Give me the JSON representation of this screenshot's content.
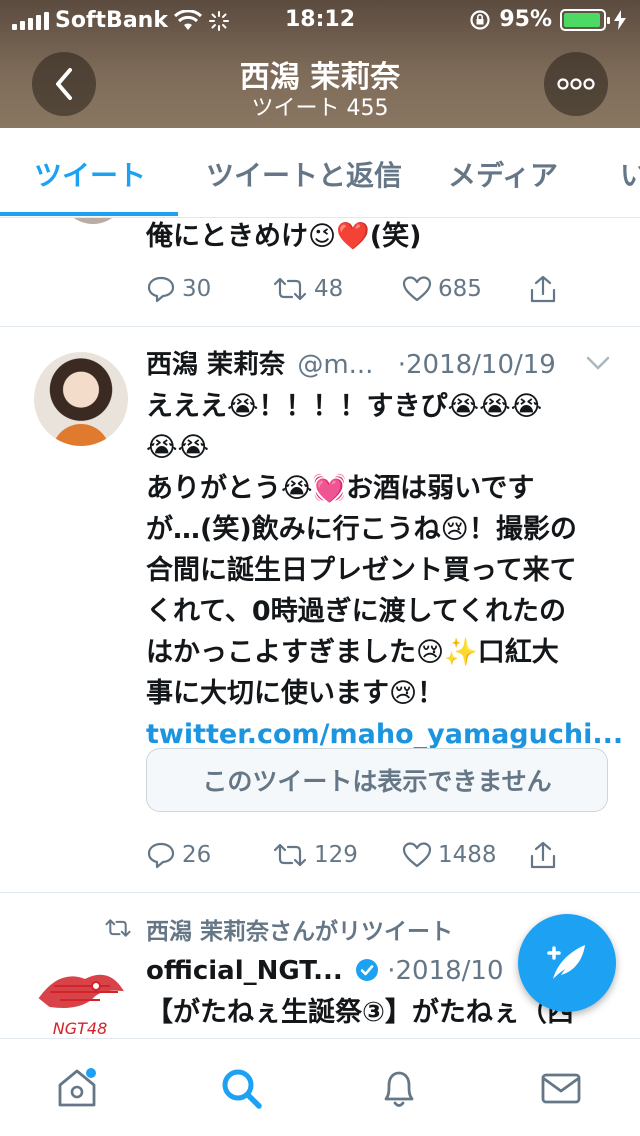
{
  "status_bar": {
    "carrier": "SoftBank",
    "time": "18:12",
    "battery": "95%",
    "battery_level": 0.95
  },
  "header": {
    "title": "西潟 茉莉奈",
    "subtitle": "ツイート 455",
    "icons": {
      "back": "chevron-left-icon",
      "more": "more-dots-icon"
    }
  },
  "tabs": [
    {
      "label": "ツイート",
      "active": true
    },
    {
      "label": "ツイートと返信",
      "active": false
    },
    {
      "label": "メディア",
      "active": false
    },
    {
      "label": "い",
      "active": false
    }
  ],
  "tweets": [
    {
      "text_line": "俺にときめけ😉❤️(笑)",
      "replies": "30",
      "retweets": "48",
      "likes": "685"
    },
    {
      "author": "西潟 茉莉奈",
      "handle": "@m...",
      "date": "·2018/10/19",
      "lines": [
        "えええ😭！！！！すきぴ😭😭😭",
        "😭😭",
        "ありがとう😭💓お酒は弱いです",
        "が…(笑)飲みに行こうね😢！撮影の",
        "合間に誕生日プレゼント買って来て",
        "くれて、0時過ぎに渡してくれたの",
        "はかっこよすぎました😢✨口紅大",
        "事に大切に使います😢！"
      ],
      "link": "twitter.com/maho_yamaguchi...",
      "card_text": "このツイートは表示できません",
      "replies": "26",
      "retweets": "129",
      "likes": "1488"
    },
    {
      "retweet_label": "西潟 茉莉奈さんがリツイート",
      "author": "official_NGT...",
      "date": "·2018/10",
      "lines": [
        "【がたねぇ生誕祭③】がたねぇ（西"
      ],
      "logo_text": "NGT48"
    }
  ],
  "bottom_nav": [
    {
      "icon": "home-icon",
      "active": false
    },
    {
      "icon": "search-icon",
      "active": true
    },
    {
      "icon": "bell-icon",
      "active": false
    },
    {
      "icon": "mail-icon",
      "active": false
    }
  ],
  "colors": {
    "accent": "#1da1f2",
    "muted": "#657786",
    "text": "#14171a"
  }
}
